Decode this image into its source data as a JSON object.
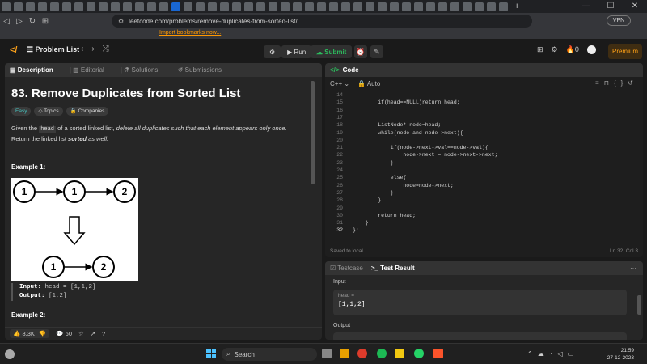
{
  "browser": {
    "url": "leetcode.com/problems/remove-duplicates-from-sorted-list/",
    "bookmark_prompt": "Import bookmarks now...",
    "vpn_label": "VPN",
    "window_controls": [
      "—",
      "☐",
      "✕"
    ]
  },
  "leetcode_nav": {
    "menu_label": "Problem List",
    "run_label": "Run",
    "submit_label": "Submit",
    "streak_count": "0",
    "premium_label": "Premium"
  },
  "left_panel": {
    "tabs": [
      {
        "label": "Description",
        "active": true
      },
      {
        "label": "Editorial",
        "active": false
      },
      {
        "label": "Solutions",
        "active": false
      },
      {
        "label": "Submissions",
        "active": false
      }
    ],
    "title": "83. Remove Duplicates from Sorted List",
    "badges": {
      "difficulty": "Easy",
      "topics": "Topics",
      "companies": "Companies"
    },
    "description": {
      "p1": "Given the",
      "code": "head",
      "p2": "of a sorted linked list,",
      "em": "delete all duplicates such that each element appears only once",
      "p3": ". Return the linked list",
      "strong": "sorted",
      "p4": "as well."
    },
    "example1_heading": "Example 1:",
    "example1": {
      "input_label": "Input:",
      "input_value": "head = [1,1,2]",
      "output_label": "Output:",
      "output_value": "[1,2]",
      "diagram_nodes_before": [
        "1",
        "1",
        "2"
      ],
      "diagram_nodes_after": [
        "1",
        "2"
      ]
    },
    "example2_heading": "Example 2:",
    "likes": "8.3K",
    "comments": "60"
  },
  "code_panel": {
    "tab_label": "Code",
    "language": "C++",
    "mode": "Auto",
    "lines": [
      {
        "n": "14",
        "code": ""
      },
      {
        "n": "15",
        "code": "        if(head==NULL)return head;"
      },
      {
        "n": "16",
        "code": ""
      },
      {
        "n": "17",
        "code": ""
      },
      {
        "n": "18",
        "code": "        ListNode* node=head;"
      },
      {
        "n": "19",
        "code": "        while(node and node->next){"
      },
      {
        "n": "20",
        "code": ""
      },
      {
        "n": "21",
        "code": "            if(node->next->val==node->val){"
      },
      {
        "n": "22",
        "code": "                node->next = node->next->next;"
      },
      {
        "n": "23",
        "code": "            }"
      },
      {
        "n": "24",
        "code": ""
      },
      {
        "n": "25",
        "code": "            else{"
      },
      {
        "n": "26",
        "code": "                node=node->next;"
      },
      {
        "n": "27",
        "code": "            }"
      },
      {
        "n": "28",
        "code": "        }"
      },
      {
        "n": "29",
        "code": ""
      },
      {
        "n": "30",
        "code": "        return head;"
      },
      {
        "n": "31",
        "code": "    }"
      },
      {
        "n": "32",
        "code": "};"
      }
    ],
    "current_line": "32",
    "save_status": "Saved to local",
    "cursor_pos": "Ln 32, Col 3"
  },
  "test_panel": {
    "tabs": [
      {
        "label": "Testcase",
        "active": false
      },
      {
        "label": "Test Result",
        "active": true
      }
    ],
    "input_heading": "Input",
    "input_var": "head =",
    "input_value": "[1,1,2]",
    "output_heading": "Output"
  },
  "taskbar": {
    "search_label": "Search",
    "time": "21:59",
    "date": "27-12-2023"
  },
  "colors": {
    "accent_orange": "#ffa116",
    "submit_green": "#2cbb5d",
    "easy_teal": "#46c6c2"
  }
}
